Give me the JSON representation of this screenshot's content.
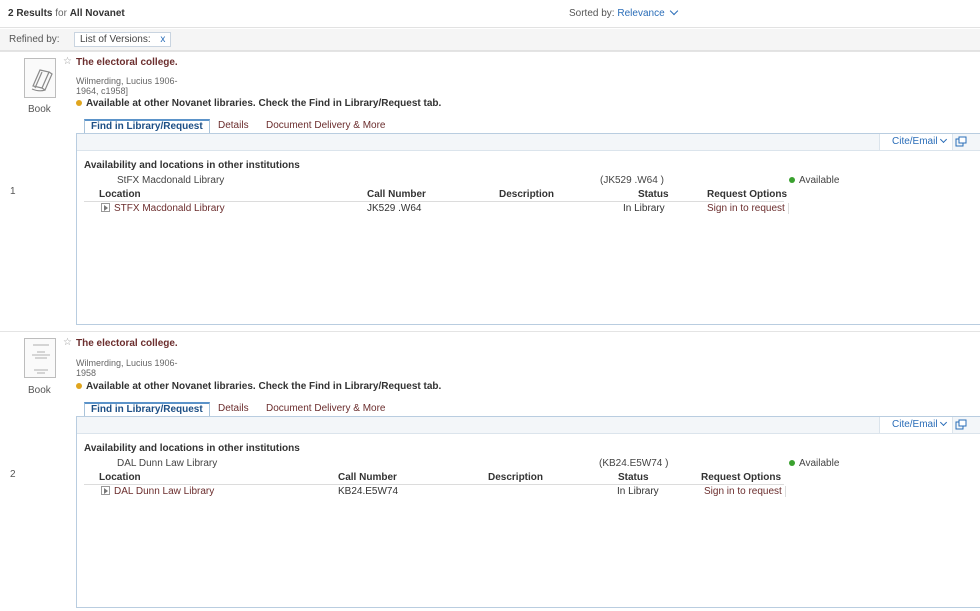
{
  "header": {
    "results_count": "2 Results",
    "results_for": "for",
    "scope": "All Novanet",
    "sorted_label": "Sorted by:",
    "sorted_value": "Relevance"
  },
  "refine": {
    "label": "Refined by:",
    "chip_label": "List of Versions:",
    "chip_remove": "x"
  },
  "records": [
    {
      "index": "1",
      "type": "Book",
      "title": "The electoral college.",
      "author_line1": "Wilmerding, Lucius 1906-",
      "author_line2": "1964, c1958]",
      "availability": "Available at other Novanet libraries. Check the Find in Library/Request tab.",
      "tabs": [
        "Find in Library/Request",
        "Details",
        "Document Delivery & More"
      ],
      "cite_label": "Cite/Email",
      "panel_heading": "Availability and locations in other institutions",
      "library": "StFX Macdonald Library",
      "call_number_summary": "(JK529 .W64 )",
      "availability_status": "Available",
      "columns": [
        "Location",
        "Call Number",
        "Description",
        "Status",
        "Request Options"
      ],
      "item": {
        "location": "STFX Macdonald Library",
        "call_number": "JK529 .W64",
        "description": "",
        "status": "In Library",
        "request": "Sign in to request"
      }
    },
    {
      "index": "2",
      "type": "Book",
      "title": "The electoral college.",
      "author_line1": "Wilmerding, Lucius 1906-",
      "author_line2": "1958",
      "availability": "Available at other Novanet libraries. Check the Find in Library/Request tab.",
      "tabs": [
        "Find in Library/Request",
        "Details",
        "Document Delivery & More"
      ],
      "cite_label": "Cite/Email",
      "panel_heading": "Availability and locations in other institutions",
      "library": "DAL Dunn Law Library",
      "call_number_summary": "(KB24.E5W74 )",
      "availability_status": "Available",
      "columns": [
        "Location",
        "Call Number",
        "Description",
        "Status",
        "Request Options"
      ],
      "item": {
        "location": "DAL Dunn Law Library",
        "call_number": "KB24.E5W74",
        "description": "",
        "status": "In Library",
        "request": "Sign in to request"
      }
    }
  ],
  "icons": {
    "favorite": "star-icon",
    "book_cover": "book-cover-icon",
    "available": "status-dot-icon",
    "expand": "expand-row-icon",
    "popout": "popout-window-icon",
    "dropdown": "chevron-down-icon"
  },
  "colors": {
    "title": "#6b2d2d",
    "link": "#2a6db8",
    "available_green": "#3aa12f",
    "available_amber": "#e0a51e"
  }
}
